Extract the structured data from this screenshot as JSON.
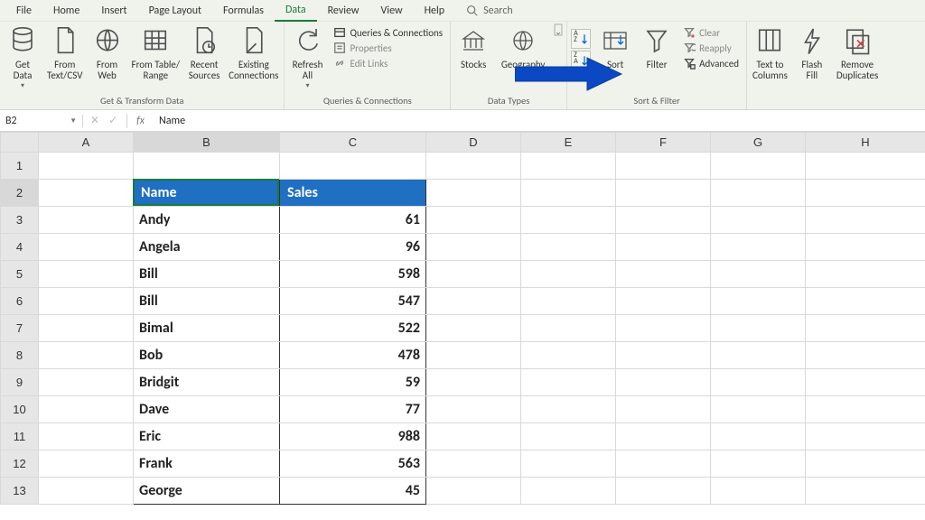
{
  "tabs": {
    "file": "File",
    "home": "Home",
    "insert": "Insert",
    "page_layout": "Page Layout",
    "formulas": "Formulas",
    "data": "Data",
    "review": "Review",
    "view": "View",
    "help": "Help",
    "search": "Search"
  },
  "ribbon": {
    "get_transform": {
      "label": "Get & Transform Data",
      "get_data": "Get\nData",
      "from_textcsv": "From\nText/CSV",
      "from_web": "From\nWeb",
      "from_table": "From Table/\nRange",
      "recent": "Recent\nSources",
      "existing": "Existing\nConnections"
    },
    "queries": {
      "label": "Queries & Connections",
      "refresh": "Refresh\nAll",
      "queries_conn": "Queries & Connections",
      "properties": "Properties",
      "edit_links": "Edit Links"
    },
    "data_types": {
      "label": "Data Types",
      "stocks": "Stocks",
      "geography": "Geography"
    },
    "sort_filter": {
      "label": "Sort & Filter",
      "sort": "Sort",
      "filter": "Filter",
      "clear": "Clear",
      "reapply": "Reapply",
      "advanced": "Advanced"
    },
    "data_tools": {
      "text_to_columns": "Text to\nColumns",
      "flash_fill": "Flash\nFill",
      "remove_dup": "Remove\nDuplicates"
    }
  },
  "formula_bar": {
    "cell_ref": "B2",
    "value": "Name"
  },
  "columns": [
    "A",
    "B",
    "C",
    "D",
    "E",
    "F",
    "G",
    "H"
  ],
  "rows": [
    "1",
    "2",
    "3",
    "4",
    "5",
    "6",
    "7",
    "8",
    "9",
    "10",
    "11",
    "12",
    "13"
  ],
  "active_cell": "B2",
  "table": {
    "headers": {
      "name": "Name",
      "sales": "Sales"
    },
    "data": [
      {
        "name": "Andy",
        "sales": 61
      },
      {
        "name": "Angela",
        "sales": 96
      },
      {
        "name": "Bill",
        "sales": 598
      },
      {
        "name": "Bill",
        "sales": 547
      },
      {
        "name": "Bimal",
        "sales": 522
      },
      {
        "name": "Bob",
        "sales": 478
      },
      {
        "name": "Bridgit",
        "sales": 59
      },
      {
        "name": "Dave",
        "sales": 77
      },
      {
        "name": "Eric",
        "sales": 988
      },
      {
        "name": "Frank",
        "sales": 563
      },
      {
        "name": "George",
        "sales": 45
      }
    ]
  }
}
